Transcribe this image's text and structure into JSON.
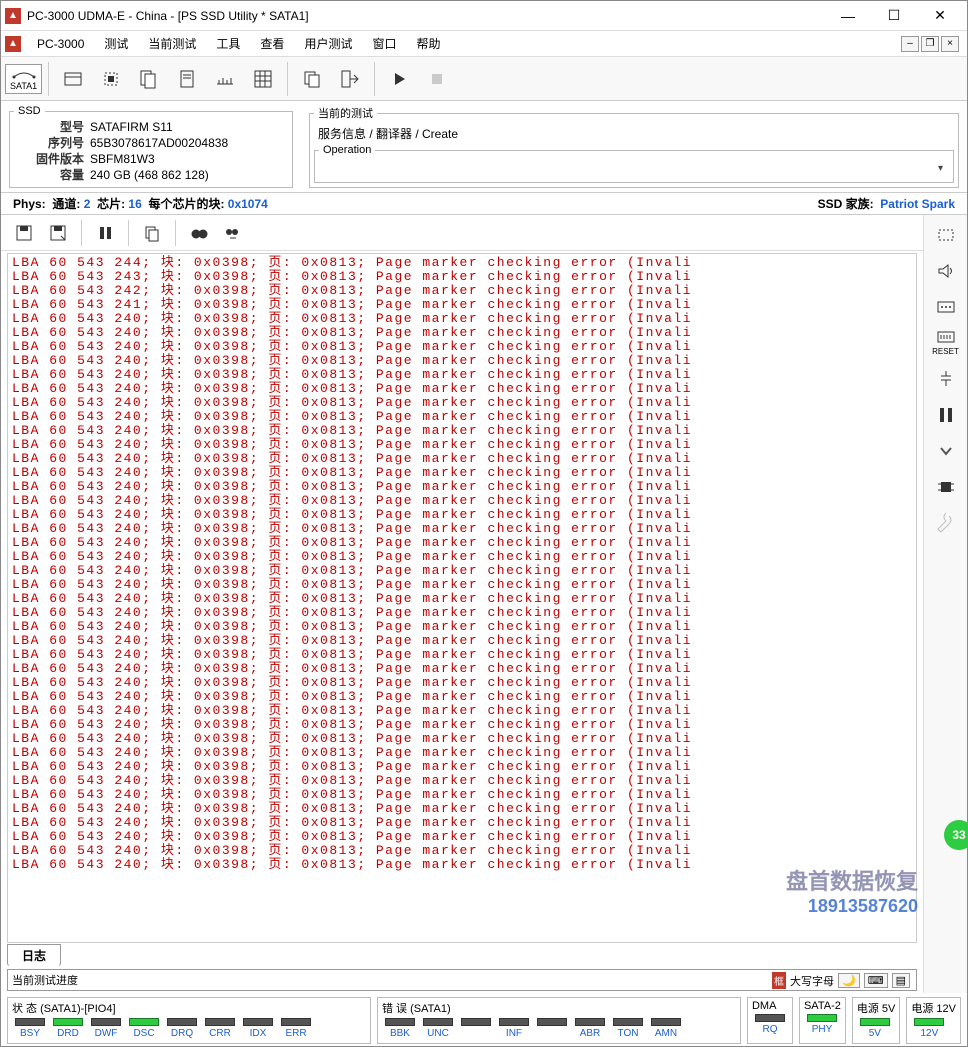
{
  "window": {
    "title": "PC-3000 UDMA-E - China - [PS SSD Utility * SATA1]",
    "app_label": "PC-3000"
  },
  "menu": {
    "items": [
      "测试",
      "当前测试",
      "工具",
      "查看",
      "用户测试",
      "窗口",
      "帮助"
    ]
  },
  "toolbar": {
    "sata_tab": "SATA1"
  },
  "ssd": {
    "legend": "SSD",
    "model_k": "型号",
    "model_v": "SATAFIRM   S11",
    "serial_k": "序列号",
    "serial_v": "65B3078617AD00204838",
    "fw_k": "固件版本",
    "fw_v": "SBFM81W3",
    "cap_k": "容量",
    "cap_v": "240 GB (468 862 128)"
  },
  "current_test": {
    "legend": "当前的测试",
    "path": "服务信息 / 翻译器 / Create",
    "operation_legend": "Operation"
  },
  "phys": {
    "label": "Phys:",
    "ch_k": "通道:",
    "ch_v": "2",
    "chip_k": "芯片:",
    "chip_v": "16",
    "blocks_k": "每个芯片的块:",
    "blocks_v": "0x1074",
    "family_k": "SSD 家族:",
    "family_v": "Patriot Spark"
  },
  "log": {
    "line_template": "LBA 60 543 {n}; 块: 0x0398; 页: 0x0813; Page marker checking error (Invali",
    "first_nums": [
      "244",
      "243",
      "242",
      "241",
      "240"
    ],
    "repeat_num": "240",
    "total_lines": 44
  },
  "tabs": {
    "log": "日志"
  },
  "progress": {
    "label": "当前测试进度"
  },
  "tray": {
    "caps": "大写字母",
    "moon": "🌙"
  },
  "status_groups": {
    "sata1": {
      "label": "状 态 (SATA1)-[PIO4]",
      "leds": [
        {
          "lbl": "BSY",
          "on": false
        },
        {
          "lbl": "DRD",
          "on": true
        },
        {
          "lbl": "DWF",
          "on": false
        },
        {
          "lbl": "DSC",
          "on": true
        },
        {
          "lbl": "DRQ",
          "on": false
        },
        {
          "lbl": "CRR",
          "on": false
        },
        {
          "lbl": "IDX",
          "on": false
        },
        {
          "lbl": "ERR",
          "on": false
        }
      ]
    },
    "err": {
      "label": "错 误 (SATA1)",
      "leds": [
        {
          "lbl": "BBK",
          "on": false
        },
        {
          "lbl": "UNC",
          "on": false
        },
        {
          "lbl": "",
          "on": false
        },
        {
          "lbl": "INF",
          "on": false
        },
        {
          "lbl": "",
          "on": false
        },
        {
          "lbl": "ABR",
          "on": false
        },
        {
          "lbl": "TON",
          "on": false
        },
        {
          "lbl": "AMN",
          "on": false
        }
      ]
    },
    "dma": {
      "label": "DMA",
      "leds": [
        {
          "lbl": "RQ",
          "on": false
        }
      ]
    },
    "sata2": {
      "label": "SATA-2",
      "leds": [
        {
          "lbl": "PHY",
          "on": true
        }
      ]
    },
    "p5": {
      "label": "电源 5V",
      "leds": [
        {
          "lbl": "5V",
          "on": true
        }
      ]
    },
    "p12": {
      "label": "电源 12V",
      "leds": [
        {
          "lbl": "12V",
          "on": true
        }
      ]
    }
  },
  "side": {
    "reset": "RESET"
  },
  "watermark": {
    "t1": "盘首数据恢复",
    "t2": "18913587620"
  },
  "badge": "33"
}
